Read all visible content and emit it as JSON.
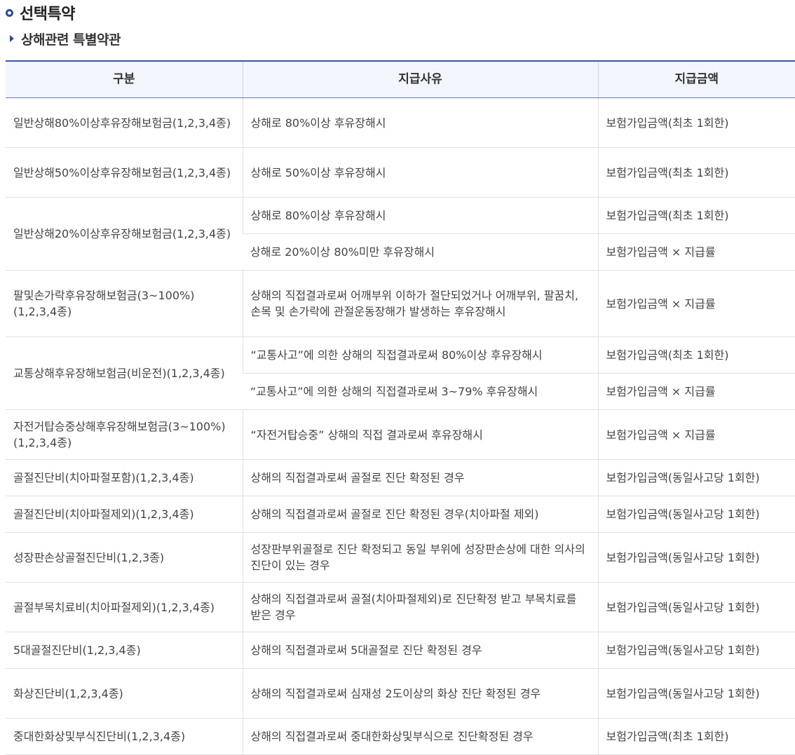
{
  "page": {
    "title": "선택특약",
    "subtitle": "상해관련 특별약관"
  },
  "table": {
    "headers": [
      "구분",
      "지급사유",
      "지급금액"
    ],
    "rows": [
      {
        "category": "일반상해80%이상후유장해보험금(1,2,3,4종)",
        "items": [
          {
            "reason": "상해로 80%이상 후유장해시",
            "amount": "보험가입금액(최초 1회한)"
          }
        ]
      },
      {
        "category": "일반상해50%이상후유장해보험금(1,2,3,4종)",
        "items": [
          {
            "reason": "상해로 50%이상 후유장해시",
            "amount": "보험가입금액(최초 1회한)"
          }
        ]
      },
      {
        "category": "일반상해20%이상후유장해보험금(1,2,3,4종)",
        "items": [
          {
            "reason": "상해로 80%이상 후유장해시",
            "amount": "보험가입금액(최초 1회한)"
          },
          {
            "reason": "상해로 20%이상 80%미만 후유장해시",
            "amount": "보험가입금액 × 지급률"
          }
        ]
      },
      {
        "category": "팔및손가락후유장해보험금(3~100%)(1,2,3,4종)",
        "items": [
          {
            "reason": "상해의 직접결과로써 어깨부위 이하가 절단되었거나 어깨부위, 팔꿈치, 손목 및 손가락에 관절운동장해가 발생하는 후유장해시",
            "amount": "보험가입금액 × 지급률"
          }
        ]
      },
      {
        "category": "교통상해후유장해보험금(비운전)(1,2,3,4종)",
        "items": [
          {
            "reason": "“교통사고”에 의한 상해의 직접결과로써 80%이상 후유장해시",
            "amount": "보험가입금액(최초 1회한)"
          },
          {
            "reason": "“교통사고”에 의한 상해의 직접결과로써 3~79% 후유장해시",
            "amount": "보험가입금액 × 지급률"
          }
        ]
      },
      {
        "category": "자전거탑승중상해후유장해보험금(3~100%)(1,2,3,4종)",
        "items": [
          {
            "reason": "“자전거탑승중” 상해의 직접 결과로써 후유장해시",
            "amount": "보험가입금액 × 지급률"
          }
        ]
      },
      {
        "category": "골절진단비(치아파절포함)(1,2,3,4종)",
        "items": [
          {
            "reason": "상해의 직접결과로써 골절로 진단 확정된 경우",
            "amount": "보험가입금액(동일사고당 1회한)"
          }
        ]
      },
      {
        "category": "골절진단비(치아파절제외)(1,2,3,4종)",
        "items": [
          {
            "reason": "상해의 직접결과로써 골절로 진단 확정된 경우(치아파절 제외)",
            "amount": "보험가입금액(동일사고당 1회한)"
          }
        ]
      },
      {
        "category": "성장판손상골절진단비(1,2,3종)",
        "items": [
          {
            "reason": "성장판부위골절로 진단 확정되고 동일 부위에 성장판손상에 대한 의사의 진단이 있는 경우",
            "amount": "보험가입금액(동일사고당 1회한)"
          }
        ]
      },
      {
        "category": "골절부목치료비(치아파절제외)(1,2,3,4종)",
        "items": [
          {
            "reason": "상해의 직접결과로써 골절(치아파절제외)로 진단확정 받고 부목치료를 받은 경우",
            "amount": "보험가입금액(동일사고당 1회한)"
          }
        ]
      },
      {
        "category": "5대골절진단비(1,2,3,4종)",
        "items": [
          {
            "reason": "상해의 직접결과로써 5대골절로 진단 확정된 경우",
            "amount": "보험가입금액(동일사고당 1회한)"
          }
        ]
      },
      {
        "category": "화상진단비(1,2,3,4종)",
        "items": [
          {
            "reason": "상해의 직접결과로써 심재성 2도이상의 화상 진단 확정된 경우",
            "amount": "보험가입금액(동일사고당 1회한)"
          }
        ]
      },
      {
        "category": "중대한화상및부식진단비(1,2,3,4종)",
        "items": [
          {
            "reason": "상해의 직접결과로써 중대한화상및부식으로 진단확정된 경우",
            "amount": "보험가입금액(최초 1회한)"
          }
        ]
      }
    ]
  }
}
